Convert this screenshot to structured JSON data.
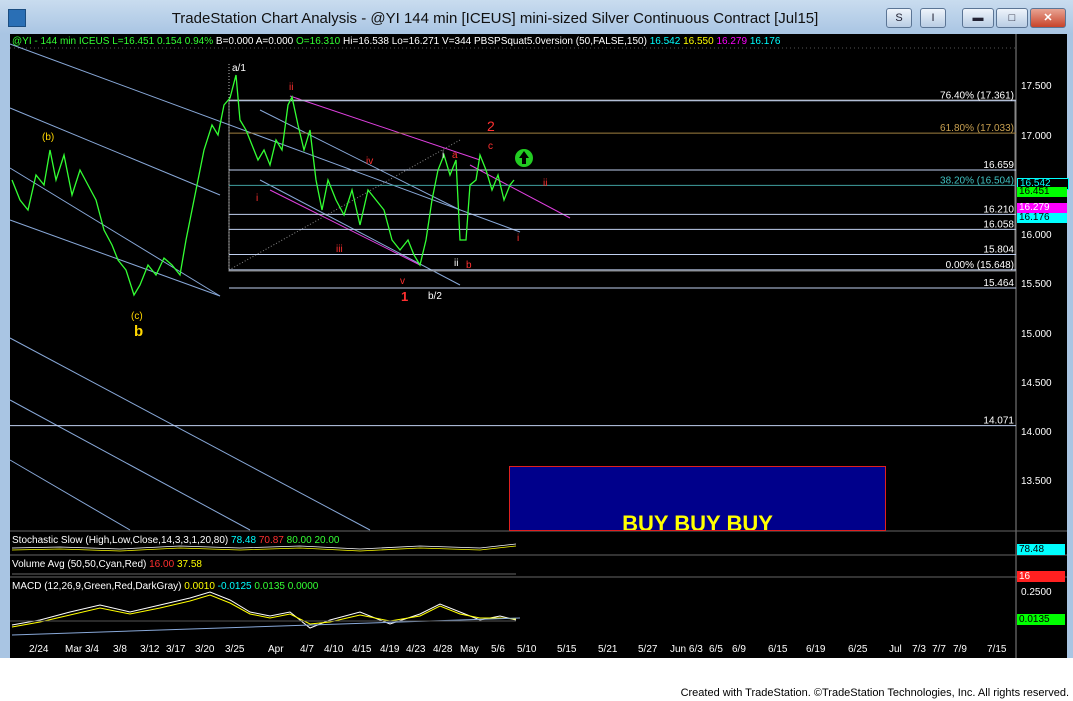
{
  "window": {
    "title": "TradeStation Chart Analysis - @YI 144 min [ICEUS] mini-sized Silver Continuous Contract [Jul15]",
    "buttons": {
      "s": "S",
      "i": "I",
      "minimize": "▬",
      "maximize": "□",
      "close": "✕"
    }
  },
  "header": {
    "symbol": "@YI - 144 min",
    "exchange": "ICEUS",
    "last": "L=16.451",
    "change": "0.154",
    "pct": "0.94%",
    "bid": "B=0.000",
    "ask": "A=0.000",
    "open": "O=16.310",
    "high": "Hi=16.538",
    "low": "Lo=16.271",
    "volume": "V=344",
    "study": "PBSPSquat5.0version (50,FALSE,150)",
    "study_vals": [
      "16.542",
      "16.550",
      "16.279",
      "16.176"
    ]
  },
  "price_axis": {
    "ticks": [
      "17.500",
      "17.000",
      "16.000",
      "15.500",
      "15.000",
      "14.500",
      "14.000",
      "13.500"
    ],
    "markers": [
      {
        "label": "16.542",
        "color": "#00ffff"
      },
      {
        "label": "16.451",
        "color": "#00ff00"
      },
      {
        "label": "16.279",
        "color": "#ff00ff"
      },
      {
        "label": "16.176",
        "color": "#00ffff"
      }
    ]
  },
  "levels": [
    {
      "label": "76.40% (17.361)",
      "value": 17.361
    },
    {
      "label": "61.80% (17.033)",
      "value": 17.033
    },
    {
      "label": "16.659",
      "value": 16.659
    },
    {
      "label": "38.20% (16.504)",
      "value": 16.504
    },
    {
      "label": "16.210",
      "value": 16.21
    },
    {
      "label": "16.058",
      "value": 16.058
    },
    {
      "label": "15.804",
      "value": 15.804
    },
    {
      "label": "0.00% (15.648)",
      "value": 15.648
    },
    {
      "label": "15.464",
      "value": 15.464
    },
    {
      "label": "14.071",
      "value": 14.071
    }
  ],
  "wave_labels": {
    "a1": "a/1",
    "b2": "b/2",
    "b_paren": "(b)",
    "c_paren": "(c)",
    "b_big": "b",
    "ii_top": "ii",
    "iii": "iii",
    "iv": "iv",
    "v": "v",
    "one": "1",
    "two": "2",
    "c": "c",
    "a": "a",
    "b": "b",
    "i": "i",
    "i2": "i",
    "ii2": "ii",
    "ii_right": "ii",
    "i_right": "i"
  },
  "buy_box": {
    "text": "BUY BUY BUY"
  },
  "indicators": {
    "stoch": {
      "label": "Stochastic Slow (High,Low,Close,14,3,3,1,20,80)",
      "v1": "78.48",
      "v2": "70.87",
      "v3": "80.00",
      "v4": "20.00",
      "axis": "78.48"
    },
    "volume": {
      "label": "Volume Avg (50,50,Cyan,Red)",
      "v1": "16.00",
      "v2": "37.58",
      "axis": "16"
    },
    "macd": {
      "label": "MACD (12,26,9,Green,Red,DarkGray)",
      "v1": "0.0010",
      "v2": "-0.0125",
      "v3": "0.0135",
      "v4": "0.0000",
      "axis_top": "0.2500",
      "axis_val": "0.0135"
    }
  },
  "dates": [
    "2/24",
    "Mar 3/4",
    "3/8",
    "3/12",
    "3/17",
    "3/20",
    "3/25",
    "Apr",
    "4/7",
    "4/10",
    "4/15",
    "4/19",
    "4/23",
    "4/28",
    "May",
    "5/6",
    "5/10",
    "5/15",
    "5/21",
    "5/27",
    "Jun 6/3",
    "6/5",
    "6/9",
    "6/15",
    "6/19",
    "6/25",
    "Jul",
    "7/3",
    "7/7",
    "7/9",
    "7/15"
  ],
  "footer": "Created with TradeStation. ©TradeStation Technologies, Inc. All rights reserved."
}
